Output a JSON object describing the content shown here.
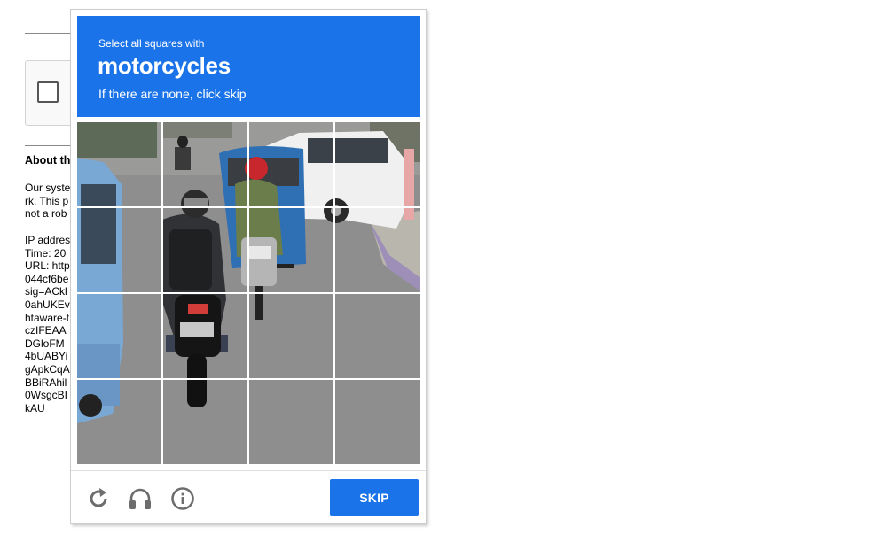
{
  "background_page": {
    "heading": "About th",
    "paragraph_lines": [
      "Our syste",
      "rk. This p",
      "not a rob"
    ],
    "detail_lines": [
      "IP addres",
      "Time: 20",
      "URL: http",
      "044cf6be",
      "sig=ACkl",
      "0ahUKEv",
      "htaware-t",
      "czIFEAA",
      "DGloFM",
      "4bUABYi",
      "gApkCqA",
      "BBiRAhil",
      "0WsgcBI",
      "kAU"
    ]
  },
  "challenge": {
    "instruction": "Select all squares with",
    "target": "motorcycles",
    "subtext": "If there are none, click skip",
    "grid": {
      "rows": 4,
      "cols": 4
    },
    "skip_label": "SKIP",
    "icons": [
      "reload-icon",
      "audio-icon",
      "info-icon"
    ]
  },
  "colors": {
    "accent": "#1a73e8",
    "icon_gray": "#757575"
  }
}
